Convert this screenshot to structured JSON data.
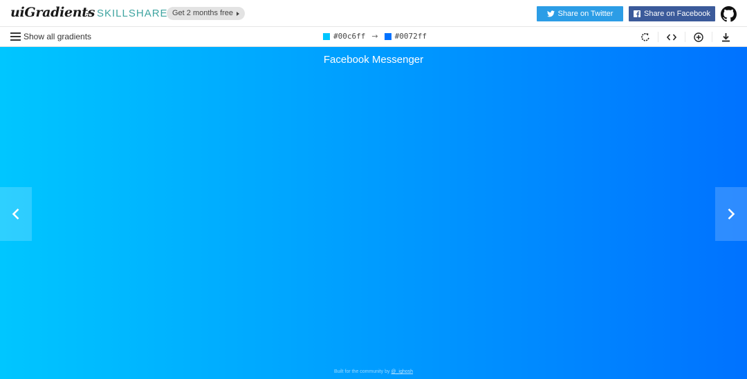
{
  "header": {
    "logo": "uiGradients",
    "plus": "+",
    "partner": "SKILLSHARE",
    "promo_label": "Get 2 months free",
    "twitter_label": "Share on Twitter",
    "facebook_label": "Share on Facebook",
    "github_icon": "github-icon"
  },
  "toolbar": {
    "menu_label": "Show all gradients",
    "color_start": "#00c6ff",
    "arrow": "→",
    "color_end": "#0072ff",
    "tools": [
      "rotate-icon",
      "code-icon",
      "add-icon",
      "download-icon"
    ]
  },
  "gradient": {
    "name": "Facebook Messenger",
    "colors": [
      "#00c6ff",
      "#0072ff"
    ]
  },
  "footer": {
    "credit_prefix": "Built for the community by",
    "credit_handle": "@_ighosh"
  }
}
